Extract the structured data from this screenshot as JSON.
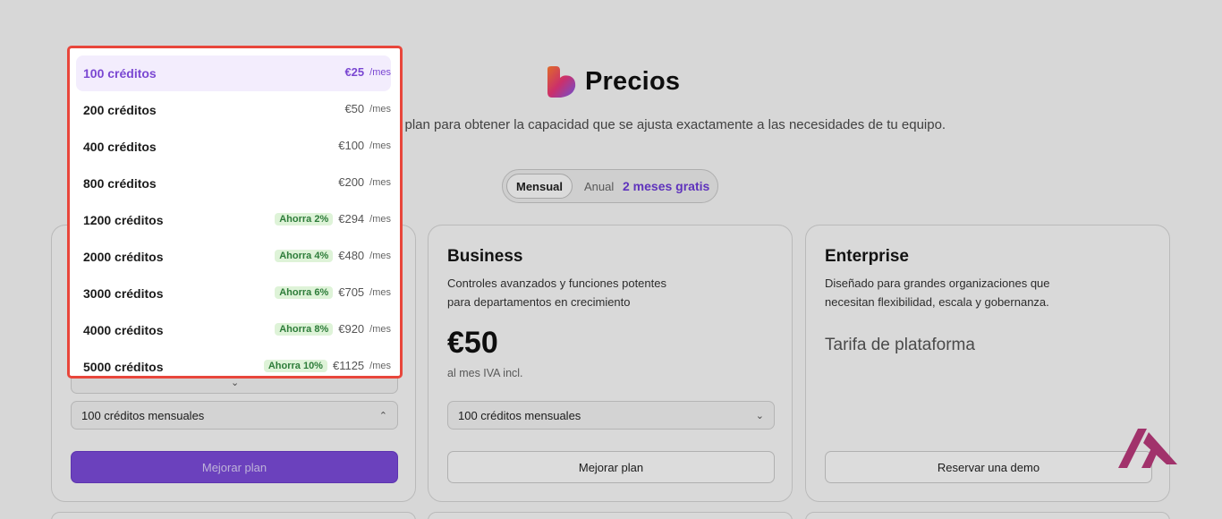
{
  "header": {
    "title": "Precios",
    "subtitle": "u plan para obtener la capacidad que se ajusta exactamente a las necesidades de tu equipo."
  },
  "billing_toggle": {
    "monthly_label": "Mensual",
    "annual_label": "Anual",
    "promo_label": "2 meses gratis",
    "selected": "Mensual"
  },
  "plans": [
    {
      "name": "",
      "upper_select_value": "",
      "credits_select_value": "100 créditos mensuales",
      "button_label": "Mejorar plan"
    },
    {
      "name": "Business",
      "description_line1": "Controles avanzados y funciones potentes",
      "description_line2": "para departamentos en crecimiento",
      "price": "€50",
      "price_note": "al mes IVA incl.",
      "credits_select_value": "100 créditos mensuales",
      "button_label": "Mejorar plan"
    },
    {
      "name": "Enterprise",
      "description_line1": "Diseñado para grandes organizaciones que",
      "description_line2": "necesitan flexibilidad, escala y gobernanza.",
      "platform_label": "Tarifa de plataforma",
      "button_label": "Reservar una demo"
    }
  ],
  "dropdown": {
    "unit": "/mes",
    "options": [
      {
        "label": "100 créditos",
        "price": "€25",
        "badge": "",
        "selected": true
      },
      {
        "label": "200 créditos",
        "price": "€50",
        "badge": ""
      },
      {
        "label": "400 créditos",
        "price": "€100",
        "badge": ""
      },
      {
        "label": "800 créditos",
        "price": "€200",
        "badge": ""
      },
      {
        "label": "1200 créditos",
        "price": "€294",
        "badge": "Ahorra 2%"
      },
      {
        "label": "2000 créditos",
        "price": "€480",
        "badge": "Ahorra 4%"
      },
      {
        "label": "3000 créditos",
        "price": "€705",
        "badge": "Ahorra 6%"
      },
      {
        "label": "4000 créditos",
        "price": "€920",
        "badge": "Ahorra 8%"
      },
      {
        "label": "5000 créditos",
        "price": "€1125",
        "badge": "Ahorra 10%"
      }
    ]
  },
  "colors": {
    "accent": "#7a4ad8",
    "promo": "#6d3bd6",
    "highlight_border": "#e8463b",
    "badge_bg": "#def3d8",
    "badge_text": "#2e7d3a"
  },
  "icons": {
    "brand": "heart-logo-icon",
    "watermark": "brand-watermark-icon",
    "chevron": "chevron-down-icon"
  }
}
